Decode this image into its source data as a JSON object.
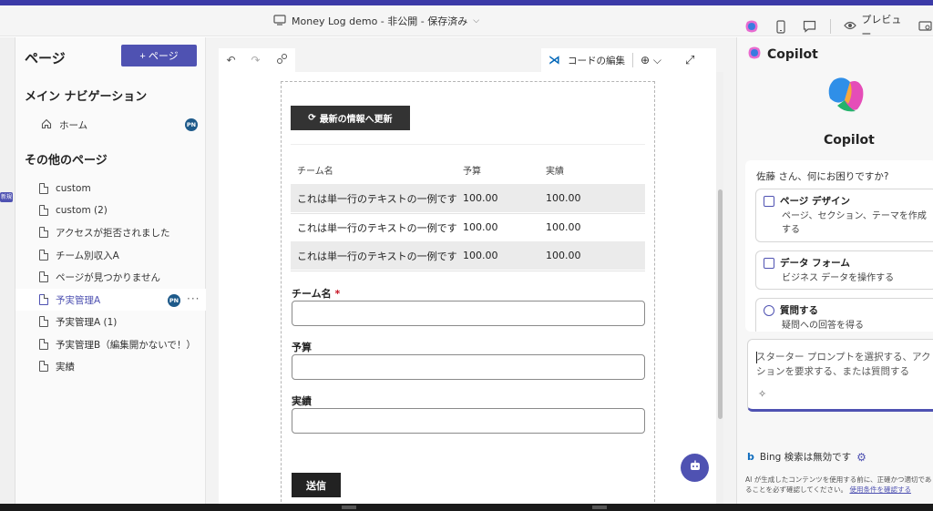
{
  "topbar": {
    "site_title": "Money Log demo - 非公開 - 保存済み",
    "preview_label": "プレビュー"
  },
  "rail": {
    "badge": "新規"
  },
  "pages_panel": {
    "title": "ページ",
    "add_button": "+ ページ",
    "main_nav_heading": "メイン ナビゲーション",
    "home_label": "ホーム",
    "owner_initials": "PN",
    "other_heading": "その他のページ",
    "items": [
      {
        "label": "custom"
      },
      {
        "label": "custom (2)"
      },
      {
        "label": "アクセスが拒否されました"
      },
      {
        "label": "チーム別収入A"
      },
      {
        "label": "ページが見つかりません"
      },
      {
        "label": "予実管理A"
      },
      {
        "label": "予実管理A (1)"
      },
      {
        "label": "予実管理B（編集開かないで！）"
      },
      {
        "label": "実績"
      }
    ],
    "more_label": "···"
  },
  "editor_toolbar": {
    "code_edit_label": "コードの編集"
  },
  "page_content": {
    "refresh_button": "最新の情報へ更新",
    "table": {
      "headers": [
        "チーム名",
        "予算",
        "実績"
      ],
      "rows": [
        [
          "これは単一行のテキストの一例です",
          "100.00",
          "100.00"
        ],
        [
          "これは単一行のテキストの一例です",
          "100.00",
          "100.00"
        ],
        [
          "これは単一行のテキストの一例です",
          "100.00",
          "100.00"
        ]
      ]
    },
    "form": {
      "team_label": "チーム名",
      "required_mark": "*",
      "budget_label": "予算",
      "actual_label": "実績",
      "submit_label": "送信"
    }
  },
  "copilot": {
    "header": "Copilot",
    "name": "Copilot",
    "greeting": "佐藤 さん、何にお困りですか?",
    "suggestions": [
      {
        "title": "ページ デザイン",
        "desc": "ページ、セクション、テーマを作成する"
      },
      {
        "title": "データ フォーム",
        "desc": "ビジネス データを操作する"
      },
      {
        "title": "質問する",
        "desc": "疑問への回答を得る"
      }
    ],
    "prompt_placeholder": "スターター プロンプトを選択する、アクションを要求する、または質問する",
    "bing_status": "Bing 検索は無効です",
    "disclaimer": "AI が生成したコンテンツを使用する前に、正確かつ適切であることを必ず確認してください。",
    "terms_link": "使用条件を確認する"
  },
  "colors": {
    "accent": "#4f52b2",
    "dark_button": "#333333",
    "required": "#c50f1f"
  }
}
